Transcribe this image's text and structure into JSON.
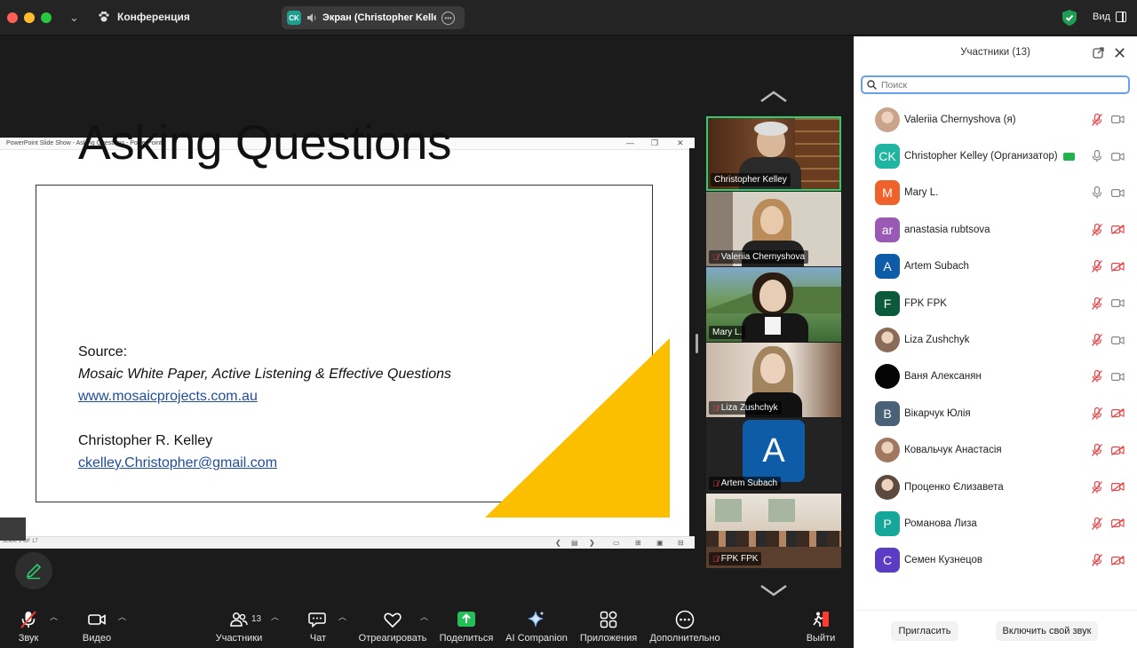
{
  "titlebar": {
    "meeting_title": "Конференция",
    "screen_badge": "CK",
    "screen_label": "Экран (Christopher Kelley",
    "view_label": "Вид"
  },
  "slide_window": {
    "title": "PowerPoint Slide Show  -  Asking Questions - PowerPoint",
    "slide_title": "Asking Questions",
    "source_label": "Source:",
    "source_title": "Mosaic White Paper, Active Listening & Effective Questions",
    "source_link": "www.mosaicprojects.com.au",
    "author": "Christopher R. Kelley",
    "email": "ckelley.Christopher@gmail.com",
    "slide_counter": "SLIDE 1 OF 17",
    "accent_color": "#fbbf00"
  },
  "video_tiles": [
    {
      "name": "Christopher Kelley",
      "muted": false
    },
    {
      "name": "Valeriia Chernyshova",
      "muted": true
    },
    {
      "name": "Mary L.",
      "muted": false
    },
    {
      "name": "Liza Zushchyk",
      "muted": true
    },
    {
      "name": "Artem Subach",
      "muted": true,
      "initial": "A"
    },
    {
      "name": "FPK FPK",
      "muted": true
    }
  ],
  "participants_panel": {
    "title": "Участники (13)",
    "search_placeholder": "Поиск",
    "invite_label": "Пригласить",
    "unmute_label": "Включить свой звук",
    "participants": [
      {
        "name": "Valeriia Chernyshova (я)",
        "initials": "",
        "color": "#c9a48a",
        "photo": true,
        "mic": "muted",
        "cam": "on"
      },
      {
        "name": "Christopher Kelley (Организатор)",
        "initials": "CK",
        "color": "#1fb5a0",
        "photo": false,
        "mic": "on",
        "cam": "on",
        "sharing": true
      },
      {
        "name": "Mary L.",
        "initials": "M",
        "color": "#f0622c",
        "photo": false,
        "mic": "on",
        "cam": "on"
      },
      {
        "name": "anastasia rubtsova",
        "initials": "ar",
        "color": "#9b59b6",
        "photo": false,
        "mic": "muted",
        "cam": "off"
      },
      {
        "name": "Artem Subach",
        "initials": "A",
        "color": "#0e5ca8",
        "photo": false,
        "mic": "muted",
        "cam": "off"
      },
      {
        "name": "FPK FPK",
        "initials": "F",
        "color": "#0b5a3c",
        "photo": false,
        "mic": "muted",
        "cam": "on"
      },
      {
        "name": "Liza Zushchyk",
        "initials": "",
        "color": "#8a6b5a",
        "photo": true,
        "mic": "muted",
        "cam": "on"
      },
      {
        "name": "Ваня Алексанян",
        "initials": "",
        "color": "#050505",
        "photo": false,
        "mic": "muted",
        "cam": "on"
      },
      {
        "name": "Вікарчук Юлія",
        "initials": "В",
        "color": "#4a6178",
        "photo": false,
        "mic": "muted",
        "cam": "off"
      },
      {
        "name": "Ковальчук Анастасія",
        "initials": "",
        "color": "#a07860",
        "photo": true,
        "mic": "muted",
        "cam": "off"
      },
      {
        "name": "Проценко Єлизавета",
        "initials": "",
        "color": "#5c4a3e",
        "photo": true,
        "mic": "muted",
        "cam": "off"
      },
      {
        "name": "Романова Лиза",
        "initials": "Р",
        "color": "#15a89a",
        "photo": false,
        "mic": "muted",
        "cam": "off"
      },
      {
        "name": "Семен Кузнецов",
        "initials": "С",
        "color": "#5b3cc4",
        "photo": false,
        "mic": "muted",
        "cam": "off"
      }
    ]
  },
  "toolbar": {
    "audio_label": "Звук",
    "video_label": "Видео",
    "participants_label": "Участники",
    "participants_count": "13",
    "chat_label": "Чат",
    "react_label": "Отреагировать",
    "share_label": "Поделиться",
    "ai_label": "AI Companion",
    "apps_label": "Приложения",
    "more_label": "Дополнительно",
    "leave_label": "Выйти"
  }
}
